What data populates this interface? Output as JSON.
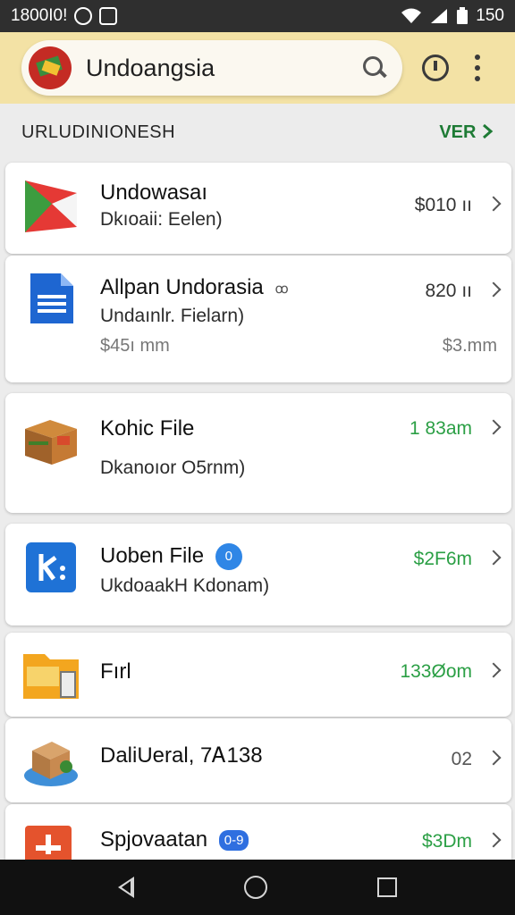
{
  "status_bar": {
    "left_text": "1800I0!",
    "right_text": "150",
    "icons": [
      "settings-icon",
      "image-icon",
      "wifi-icon",
      "signal-icon",
      "battery-icon"
    ]
  },
  "app_bar": {
    "title": "Undoangsia",
    "icons": [
      "logo-icon",
      "search-icon",
      "clock-icon",
      "more-vert-icon"
    ],
    "colors": {
      "bar": "#f3e2a5",
      "searchbox": "#fbf8f0"
    }
  },
  "section": {
    "title": "URLUDINIONESH",
    "link": "VER"
  },
  "items": [
    {
      "icon": "red-green-cube-icon",
      "title": "Undowasaı",
      "subtitle": "Dkıoaii: Eelen)",
      "right_value": "$010 ıı",
      "right_value2": ""
    },
    {
      "icon": "document-icon",
      "title": "Allpan Undorasia",
      "title_badge": "ꝏ",
      "subtitle": "Undaınlr. Fielarn)",
      "sub_value": "$45ı mm",
      "right_value": "820 ıı",
      "right_value2": "$3.mm"
    },
    {
      "icon": "box-icon",
      "title": "Kohic File",
      "subtitle": "Dkanoıor O5rnm)",
      "right_value": "1 83am",
      "right_value2": ""
    },
    {
      "icon": "puzzle-icon",
      "title": "Uoben File",
      "title_badge": "0",
      "subtitle": "UkdoaakH Kdonam)",
      "right_value": "$2F6m",
      "right_value2": ""
    },
    {
      "icon": "folder-icon",
      "title": "Fırl",
      "subtitle": "",
      "right_value": "133Øom",
      "right_value2": ""
    },
    {
      "icon": "package-icon",
      "title": "DaliUeral, 7Ꭺ138",
      "subtitle": "",
      "right_value": "02",
      "right_value2": ""
    },
    {
      "icon": "plus-icon",
      "title": "Spjovaatan",
      "title_badge": "0-9",
      "subtitle": "",
      "right_value": "$3Dm",
      "right_value2": ""
    }
  ],
  "nav_bar": {
    "icons": [
      "back-icon",
      "home-icon",
      "recent-apps-icon"
    ]
  }
}
